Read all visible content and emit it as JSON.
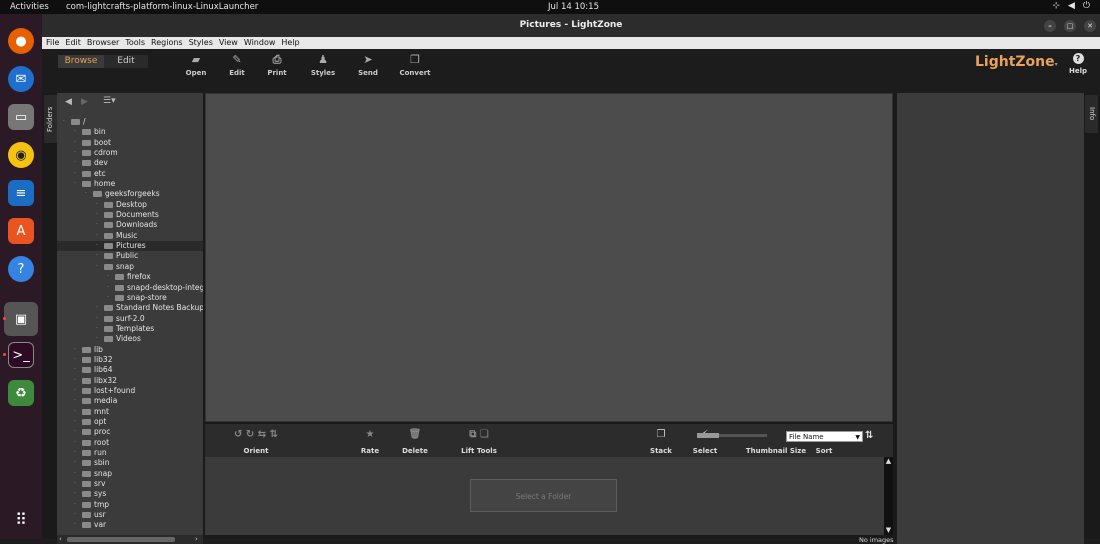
{
  "topbar": {
    "activities": "Activities",
    "app_name": "com-lightcrafts-platform-linux-LinuxLauncher",
    "clock": "Jul 14  10:15"
  },
  "window": {
    "title": "Pictures - LightZone"
  },
  "menu": [
    "File",
    "Edit",
    "Browser",
    "Tools",
    "Regions",
    "Styles",
    "View",
    "Window",
    "Help"
  ],
  "modes": {
    "browse": "Browse",
    "edit": "Edit"
  },
  "toolbar": {
    "buttons": [
      "Open",
      "Edit",
      "Print",
      "Styles",
      "Send",
      "Convert"
    ],
    "logo": "LightZone",
    "help": "Help"
  },
  "side_tabs": {
    "folders": "Folders",
    "info": "Info"
  },
  "tree": [
    {
      "label": "/",
      "depth": 0
    },
    {
      "label": "bin",
      "depth": 1
    },
    {
      "label": "boot",
      "depth": 1
    },
    {
      "label": "cdrom",
      "depth": 1
    },
    {
      "label": "dev",
      "depth": 1
    },
    {
      "label": "etc",
      "depth": 1
    },
    {
      "label": "home",
      "depth": 1
    },
    {
      "label": "geeksforgeeks",
      "depth": 2
    },
    {
      "label": "Desktop",
      "depth": 3
    },
    {
      "label": "Documents",
      "depth": 3
    },
    {
      "label": "Downloads",
      "depth": 3
    },
    {
      "label": "Music",
      "depth": 3
    },
    {
      "label": "Pictures",
      "depth": 3,
      "selected": true
    },
    {
      "label": "Public",
      "depth": 3
    },
    {
      "label": "snap",
      "depth": 3
    },
    {
      "label": "firefox",
      "depth": 4
    },
    {
      "label": "snapd-desktop-integra",
      "depth": 4
    },
    {
      "label": "snap-store",
      "depth": 4
    },
    {
      "label": "Standard Notes Backups",
      "depth": 3
    },
    {
      "label": "surf-2.0",
      "depth": 3
    },
    {
      "label": "Templates",
      "depth": 3
    },
    {
      "label": "Videos",
      "depth": 3
    },
    {
      "label": "lib",
      "depth": 1
    },
    {
      "label": "lib32",
      "depth": 1
    },
    {
      "label": "lib64",
      "depth": 1
    },
    {
      "label": "libx32",
      "depth": 1
    },
    {
      "label": "lost+found",
      "depth": 1
    },
    {
      "label": "media",
      "depth": 1
    },
    {
      "label": "mnt",
      "depth": 1
    },
    {
      "label": "opt",
      "depth": 1
    },
    {
      "label": "proc",
      "depth": 1
    },
    {
      "label": "root",
      "depth": 1
    },
    {
      "label": "run",
      "depth": 1
    },
    {
      "label": "sbin",
      "depth": 1
    },
    {
      "label": "snap",
      "depth": 1
    },
    {
      "label": "srv",
      "depth": 1
    },
    {
      "label": "sys",
      "depth": 1
    },
    {
      "label": "tmp",
      "depth": 1
    },
    {
      "label": "usr",
      "depth": 1
    },
    {
      "label": "var",
      "depth": 1
    }
  ],
  "bottom_tools": {
    "orient": "Orient",
    "rate": "Rate",
    "delete": "Delete",
    "lift_tools": "Lift Tools",
    "stack": "Stack",
    "select": "Select",
    "thumbnail_size": "Thumbnail Size",
    "sort": "Sort",
    "sort_value": "File Name"
  },
  "browser": {
    "placeholder": "Select a Folder",
    "status": "No images"
  },
  "colors": {
    "logo": "#e8a25a",
    "dock_accent": "#e95420"
  }
}
